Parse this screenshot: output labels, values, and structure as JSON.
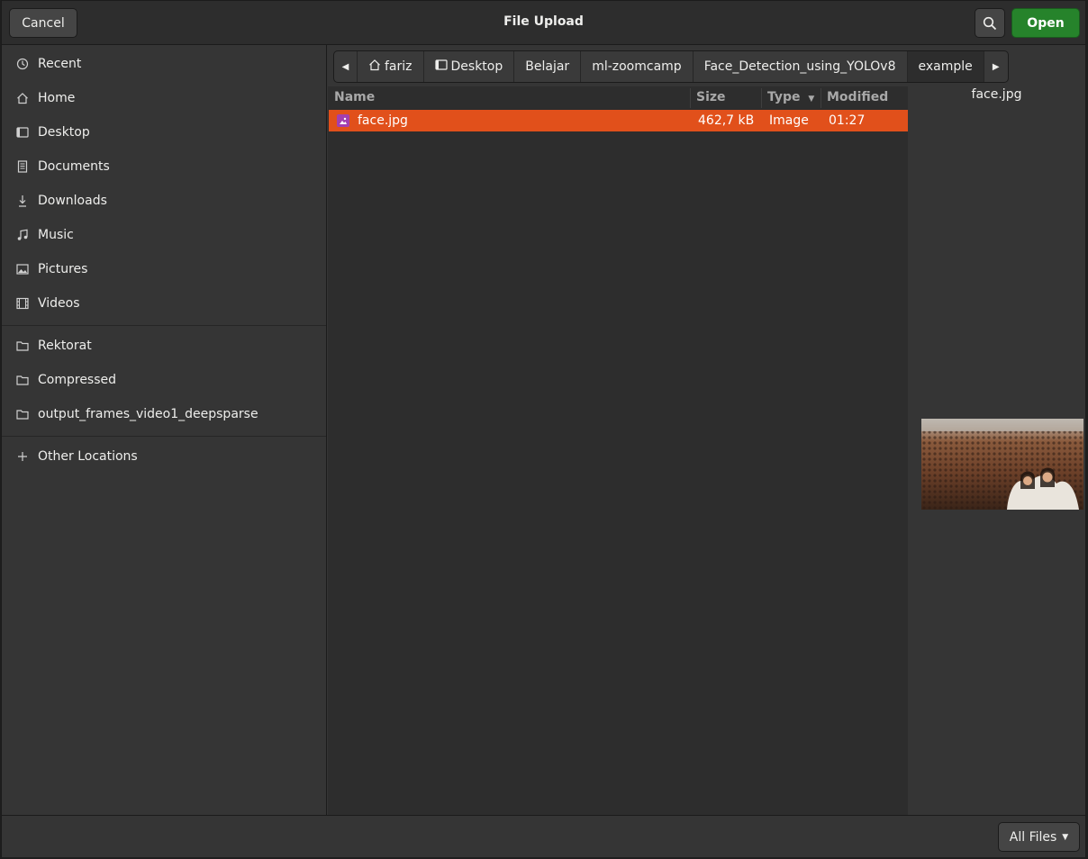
{
  "header": {
    "title": "File Upload",
    "cancel_label": "Cancel",
    "open_label": "Open",
    "accent_color": "#26832b"
  },
  "sidebar": {
    "places": [
      {
        "label": "Recent",
        "icon": "clock-icon"
      },
      {
        "label": "Home",
        "icon": "home-icon"
      },
      {
        "label": "Desktop",
        "icon": "desktop-icon"
      },
      {
        "label": "Documents",
        "icon": "document-icon"
      },
      {
        "label": "Downloads",
        "icon": "download-icon"
      },
      {
        "label": "Music",
        "icon": "music-note-icon"
      },
      {
        "label": "Pictures",
        "icon": "picture-icon"
      },
      {
        "label": "Videos",
        "icon": "film-icon"
      }
    ],
    "bookmarks": [
      {
        "label": "Rektorat",
        "icon": "folder-icon"
      },
      {
        "label": "Compressed",
        "icon": "folder-icon"
      },
      {
        "label": "output_frames_video1_deepsparse",
        "icon": "folder-icon"
      }
    ],
    "other_locations_label": "Other Locations"
  },
  "pathbar": {
    "segments": [
      "fariz",
      "Desktop",
      "Belajar",
      "ml-zoomcamp",
      "Face_Detection_using_YOLOv8",
      "example"
    ]
  },
  "filelist": {
    "columns": {
      "name": "Name",
      "size": "Size",
      "type": "Type",
      "modified": "Modified"
    },
    "rows": [
      {
        "name": "face.jpg",
        "size": "462,7 kB",
        "type": "Image",
        "modified": "01:27"
      }
    ],
    "selection_color": "#e1501b"
  },
  "preview": {
    "filename": "face.jpg"
  },
  "footer": {
    "filter_label": "All Files"
  }
}
